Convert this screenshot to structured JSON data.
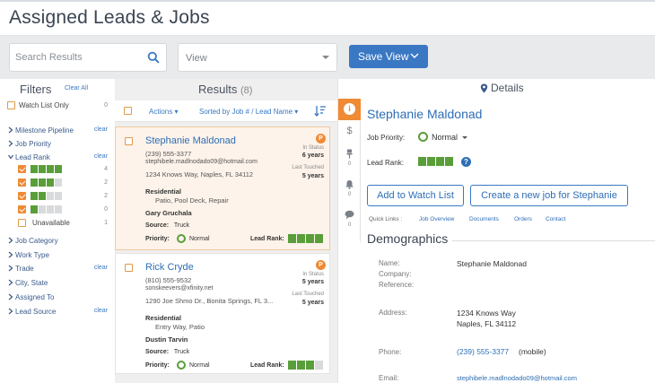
{
  "page": {
    "title": "Assigned Leads & Jobs"
  },
  "toolbar": {
    "search_placeholder": "Search Results",
    "view_label": "View",
    "save_view_label": "Save View"
  },
  "filters": {
    "title": "Filters",
    "clear_all": "Clear All",
    "watch_list_label": "Watch List Only",
    "watch_list_count": "0",
    "items": [
      {
        "label": "Milestone Pipeline",
        "clear": "clear"
      },
      {
        "label": "Job Priority",
        "clear": ""
      },
      {
        "label": "Lead Rank",
        "clear": "clear"
      },
      {
        "label": "Job Category",
        "clear": ""
      },
      {
        "label": "Work Type",
        "clear": ""
      },
      {
        "label": "Trade",
        "clear": "clear"
      },
      {
        "label": "City, State",
        "clear": ""
      },
      {
        "label": "Assigned To",
        "clear": ""
      },
      {
        "label": "Lead Source",
        "clear": "clear"
      }
    ],
    "rank_options": [
      {
        "checked": true,
        "level": 4,
        "count": "4"
      },
      {
        "checked": true,
        "level": 3,
        "count": "2"
      },
      {
        "checked": true,
        "level": 2,
        "count": "2"
      },
      {
        "checked": true,
        "level": 1,
        "count": "0"
      },
      {
        "checked": false,
        "level": 0,
        "label": "Unavailable",
        "count": "1"
      }
    ]
  },
  "results": {
    "title": "Results",
    "count": "(8)",
    "actions_label": "Actions",
    "sorted_label": "Sorted by Job # / Lead Name",
    "cards": [
      {
        "name": "Stephanie Maldonad",
        "phone": "(239) 555-3377",
        "email": "stephibele.madlnodado09@hotmail.com",
        "address": "1234 Knows Way, Naples, FL 34112",
        "type": "Residential",
        "detail": "Patio, Pool Deck, Repair",
        "person": "Gary Gruchala",
        "source_label": "Source:",
        "source": "Truck",
        "priority_label": "Priority:",
        "priority": "Normal",
        "rank_label": "Lead Rank:",
        "rank": 4,
        "badge": "P",
        "in_status_label": "In Status",
        "in_status": "6 years",
        "last_touched_label": "Last Touched",
        "last_touched": "5 years"
      },
      {
        "name": "Rick Cryde",
        "phone": "(810) 555-9532",
        "email": "sonskeevers@xfinity.net",
        "address": "1290 Joe Shmo Dr., Bonita Springs, FL 3...",
        "type": "Residential",
        "detail": "Entry Way, Patio",
        "person": "Dustin Tarvin",
        "source_label": "Source:",
        "source": "Truck",
        "priority_label": "Priority:",
        "priority": "Normal",
        "rank_label": "Lead Rank:",
        "rank": 3,
        "badge": "P",
        "in_status_label": "In Status",
        "in_status": "5 years",
        "last_touched_label": "Last Touched",
        "last_touched": "5 years"
      }
    ]
  },
  "details": {
    "title": "Details",
    "name": "Stephanie Maldonad",
    "job_priority_label": "Job Priority:",
    "job_priority": "Normal",
    "lead_rank_label": "Lead Rank:",
    "lead_rank": 4,
    "watch_button": "Add to Watch List",
    "new_job_button": "Create a new job for Stephanie",
    "quick_links_label": "Quick Links :",
    "quick_links": [
      "Job Overview",
      "Documents",
      "Orders",
      "Contact"
    ],
    "side_tab_counts": [
      "0",
      "0",
      "0"
    ],
    "demographics_title": "Demographics",
    "name_label": "Name:",
    "name_value": "Stephanie Maldonad",
    "company_label": "Company:",
    "reference_label": "Reference:",
    "address_label": "Address:",
    "address_line1": "1234 Knows Way",
    "address_line2": "Naples, FL 34112",
    "phone_label": "Phone:",
    "phone_value": "(239) 555-3377",
    "phone_type": "(mobile)",
    "email_label": "Email:",
    "email_value": "stephibele.madlnodado09@hotmail.com"
  },
  "colors": {
    "accent": "#3a78c3",
    "highlight": "#ef8a35",
    "rank_green": "#5a9e3a"
  }
}
